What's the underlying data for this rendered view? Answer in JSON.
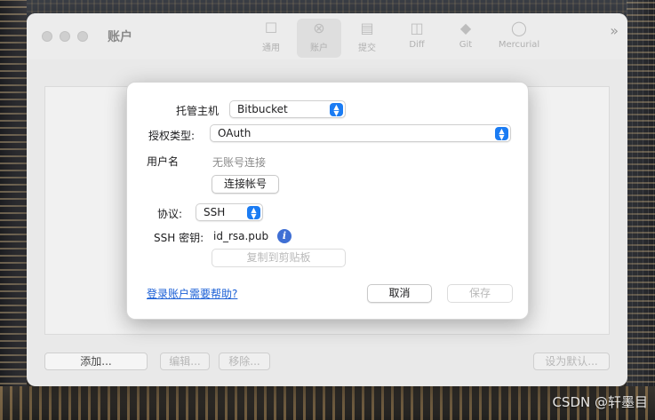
{
  "window": {
    "title": "账户",
    "toolbar": [
      {
        "label": "通用",
        "icon": "phone-icon"
      },
      {
        "label": "账户",
        "icon": "at-icon"
      },
      {
        "label": "提交",
        "icon": "document-icon"
      },
      {
        "label": "Diff",
        "icon": "diff-icon"
      },
      {
        "label": "Git",
        "icon": "git-icon"
      },
      {
        "label": "Mercurial",
        "icon": "mercurial-icon"
      }
    ],
    "bottom_buttons": {
      "add": "添加...",
      "edit": "编辑...",
      "remove": "移除...",
      "set_default": "设为默认..."
    }
  },
  "dialog": {
    "host_label": "托管主机",
    "host_value": "Bitbucket",
    "auth_label": "授权类型:",
    "auth_value": "OAuth",
    "username_label": "用户名",
    "username_value": "无账号连接",
    "connect_button": "连接帐号",
    "protocol_label": "协议:",
    "protocol_value": "SSH",
    "ssh_key_label": "SSH 密钥:",
    "ssh_key_value": "id_rsa.pub",
    "copy_button": "复制到剪贴板",
    "help_link": "登录账户需要帮助?",
    "cancel_button": "取消",
    "save_button": "保存"
  },
  "watermark": "CSDN @轩墨目"
}
